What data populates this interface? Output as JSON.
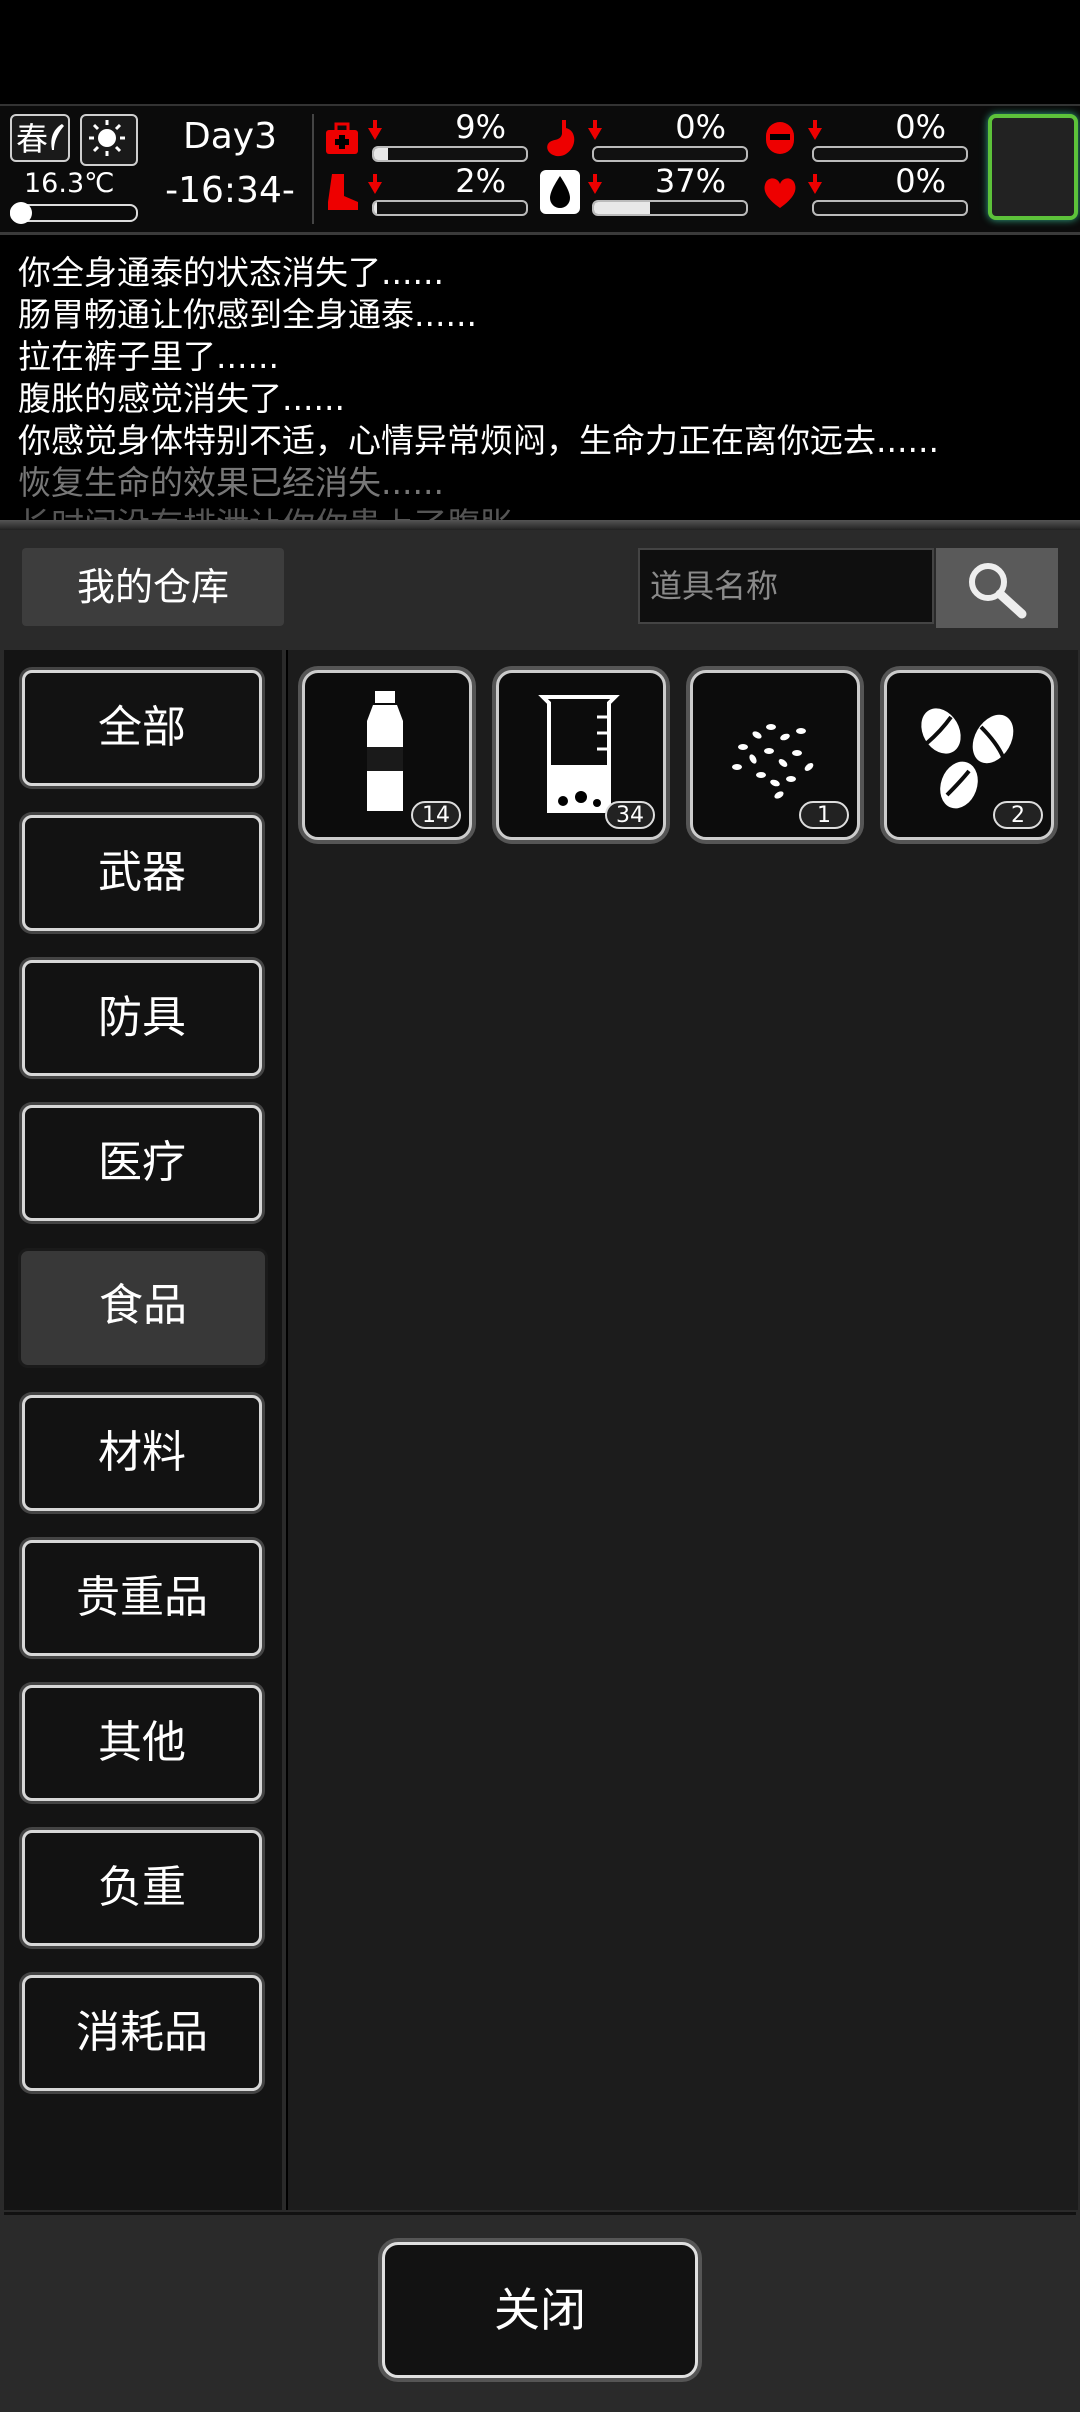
{
  "status": {
    "season": "春",
    "temperature": "16.3℃",
    "day": "Day3",
    "time": "-16:34-",
    "stats": [
      {
        "icon": "medkit-icon",
        "value": "9%",
        "fill": 0.09
      },
      {
        "icon": "stomach-icon",
        "value": "0%",
        "fill": 0.0
      },
      {
        "icon": "bladder-icon",
        "value": "0%",
        "fill": 0.0
      },
      {
        "icon": "boot-icon",
        "value": "2%",
        "fill": 0.02
      },
      {
        "icon": "water-drop-icon",
        "value": "37%",
        "fill": 0.37
      },
      {
        "icon": "heart-icon",
        "value": "0%",
        "fill": 0.0
      }
    ]
  },
  "log": [
    {
      "text": "你全身通泰的状态消失了......",
      "color": "#ffffff"
    },
    {
      "text": "肠胃畅通让你感到全身通泰......",
      "color": "#ffffff"
    },
    {
      "text": "拉在裤子里了......",
      "color": "#ffffff"
    },
    {
      "text": "腹胀的感觉消失了......",
      "color": "#ffffff"
    },
    {
      "text": "你感觉身体特别不适，心情异常烦闷，生命力正在离你远去......",
      "color": "#ffffff"
    },
    {
      "text": "恢复生命的效果已经消失......",
      "color": "#777777"
    },
    {
      "text": "长时间没有排泄让你你患上了腹胀",
      "color": "#555555"
    }
  ],
  "warehouse": {
    "title": "我的仓库",
    "search_placeholder": "道具名称"
  },
  "categories": [
    "全部",
    "武器",
    "防具",
    "医疗",
    "食品",
    "材料",
    "贵重品",
    "其他",
    "负重",
    "消耗品"
  ],
  "active_category": "食品",
  "items": [
    {
      "icon": "water-bottle-icon",
      "count": "14"
    },
    {
      "icon": "beaker-icon",
      "count": "34"
    },
    {
      "icon": "seeds-icon",
      "count": "1"
    },
    {
      "icon": "nuts-icon",
      "count": "2"
    }
  ],
  "footer": {
    "close_label": "关闭"
  }
}
